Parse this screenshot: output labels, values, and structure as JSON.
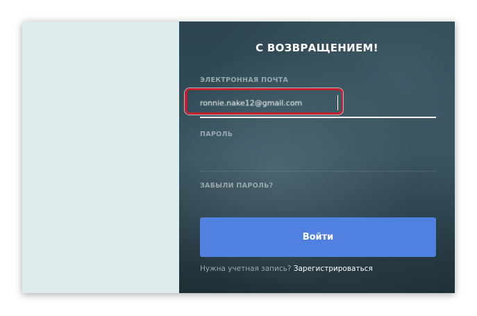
{
  "login": {
    "title": "С ВОЗВРАЩЕНИЕМ!",
    "email_label": "ЭЛЕКТРОННАЯ ПОЧТА",
    "email_value": "ronnie.nake12@gmail.com",
    "password_label": "ПАРОЛЬ",
    "password_value": "",
    "forgot_label": "ЗАБЫЛИ ПАРОЛЬ?",
    "login_button": "Войти",
    "need_account_text": "Нужна учетная запись?",
    "register_link": "Зарегистрироваться"
  },
  "colors": {
    "left_panel": "#deecec",
    "button": "#5181e0",
    "highlight": "#c8202e"
  }
}
